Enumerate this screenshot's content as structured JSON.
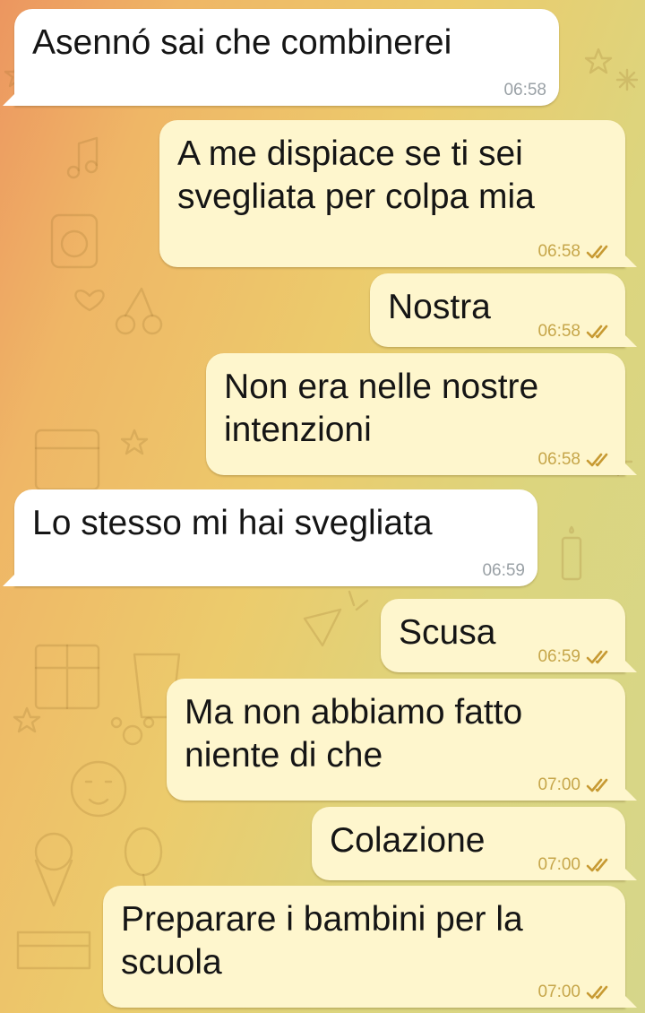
{
  "chat": {
    "messages": [
      {
        "direction": "in",
        "text": "Asennó sai che combinerei",
        "time": "06:58"
      },
      {
        "direction": "out",
        "text": "A me dispiace se ti sei\nsvegliata per colpa mia",
        "time": "06:58",
        "status_icon": "double-check-icon"
      },
      {
        "direction": "out",
        "text": "Nostra",
        "time": "06:58",
        "status_icon": "double-check-icon"
      },
      {
        "direction": "out",
        "text": "Non era nelle nostre\nintenzioni",
        "time": "06:58",
        "status_icon": "double-check-icon"
      },
      {
        "direction": "in",
        "text": "Lo stesso mi hai svegliata",
        "time": "06:59"
      },
      {
        "direction": "out",
        "text": "Scusa",
        "time": "06:59",
        "status_icon": "double-check-icon"
      },
      {
        "direction": "out",
        "text": "Ma non abbiamo fatto\nniente di che",
        "time": "07:00",
        "status_icon": "double-check-icon"
      },
      {
        "direction": "out",
        "text": "Colazione",
        "time": "07:00",
        "status_icon": "double-check-icon"
      },
      {
        "direction": "out",
        "text": "Preparare i bambini per la\nscuola",
        "time": "07:00",
        "status_icon": "double-check-icon"
      }
    ]
  },
  "theme": {
    "incoming_bubble": "#ffffff",
    "outgoing_bubble": "#fef6cd",
    "read_tick_color": "#c79a33",
    "background_gradient": [
      "#ec9660",
      "#eccb6c",
      "#d6d68a"
    ]
  }
}
